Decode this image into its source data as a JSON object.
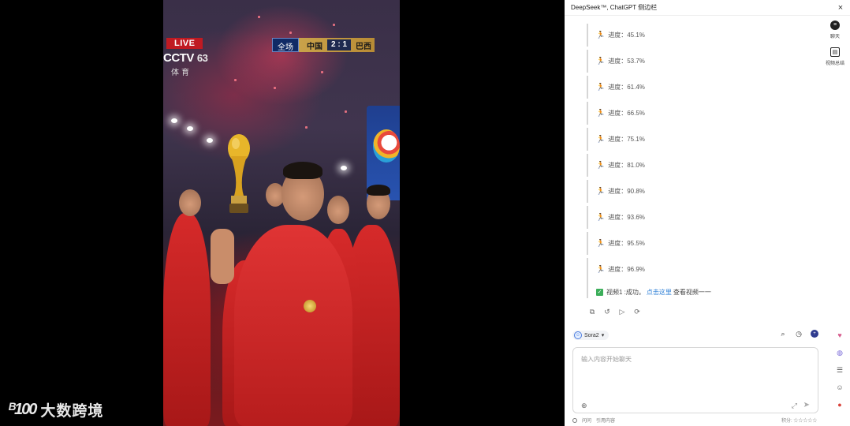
{
  "video": {
    "live_label": "LIVE",
    "channel": "CCTV",
    "channel_number": "63",
    "channel_sub": "体育",
    "scoreboard": {
      "period": "全场",
      "home": "中国",
      "score": "2 : 1",
      "away": "巴西"
    }
  },
  "watermark": {
    "mark": "ᴮ100",
    "name": "大数跨境"
  },
  "panel": {
    "title": "DeepSeek™, ChatGPT 侧边栏",
    "close": "×",
    "progress_items": [
      {
        "text": "进度：45.1%"
      },
      {
        "text": "进度：53.7%"
      },
      {
        "text": "进度：61.4%"
      },
      {
        "text": "进度：66.5%"
      },
      {
        "text": "进度：75.1%"
      },
      {
        "text": "进度：81.0%"
      },
      {
        "text": "进度：90.8%"
      },
      {
        "text": "进度：93.6%"
      },
      {
        "text": "进度：95.5%"
      },
      {
        "text": "进度：96.9%"
      }
    ],
    "done": {
      "prefix": "视频1 :成功。",
      "link": "点击这里",
      "suffix": "查看视频一一"
    },
    "rail": {
      "chat_label": "聊天",
      "summary_label": "视频总结"
    },
    "model": {
      "name": "Sora2"
    },
    "input": {
      "placeholder": "输入内容开始聊天"
    },
    "footer": {
      "left1": "问问",
      "left2": "引用内容",
      "right": "积分: ☆☆☆☆☆"
    }
  }
}
